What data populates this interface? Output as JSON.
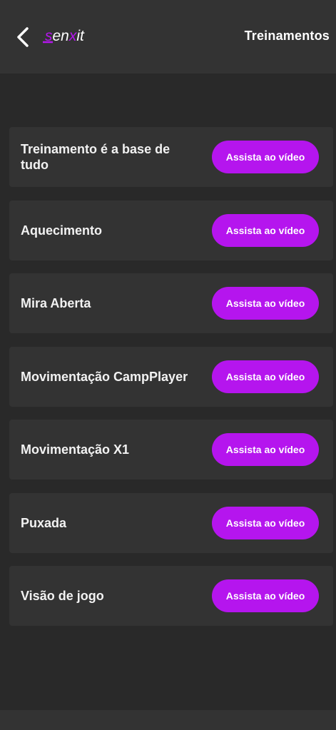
{
  "header": {
    "back_icon": "chevron-left-icon",
    "logo_text": "senxit",
    "title": "Treinamentos"
  },
  "colors": {
    "accent": "#b515ee",
    "background": "#292929",
    "card": "#333333"
  },
  "trainings": [
    {
      "title": "Treinamento é a base de tudo",
      "button_label": "Assista ao vídeo"
    },
    {
      "title": "Aquecimento",
      "button_label": "Assista ao vídeo"
    },
    {
      "title": "Mira Aberta",
      "button_label": "Assista ao vídeo"
    },
    {
      "title": "Movimentação CampPlayer",
      "button_label": "Assista ao vídeo"
    },
    {
      "title": "Movimentação X1",
      "button_label": "Assista ao vídeo"
    },
    {
      "title": "Puxada",
      "button_label": "Assista ao vídeo"
    },
    {
      "title": "Visão de jogo",
      "button_label": "Assista ao vídeo"
    }
  ]
}
